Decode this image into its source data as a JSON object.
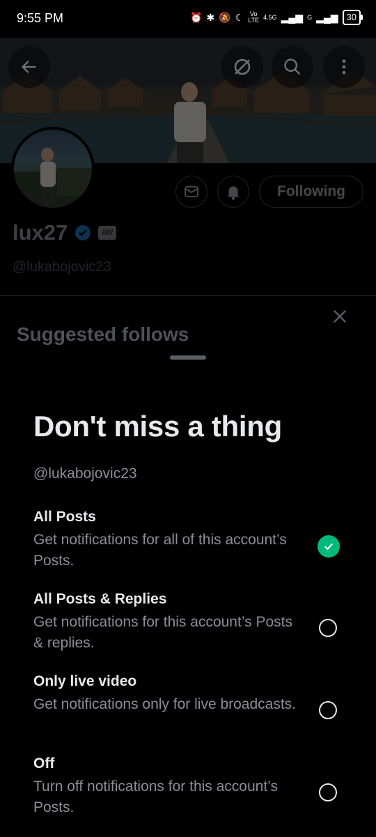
{
  "status_bar": {
    "time": "9:55 PM",
    "network_top": "Vo",
    "network_bottom": "LTE",
    "signal_label": "4.5G",
    "signal_label_2": "G",
    "battery": "30"
  },
  "profile": {
    "display_name": "lux27",
    "handle": "@lukabojovic23",
    "following_label": "Following"
  },
  "sheet": {
    "header": "Suggested follows",
    "title": "Don't miss a thing",
    "handle": "@lukabojovic23",
    "options": [
      {
        "title": "All Posts",
        "desc": "Get notifications for all of this account’s Posts.",
        "selected": true
      },
      {
        "title": "All Posts & Replies",
        "desc": "Get notifications for this account’s Posts & replies.",
        "selected": false
      },
      {
        "title": "Only live video",
        "desc": "Get notifications only for live broadcasts.",
        "selected": false
      },
      {
        "title": "Off",
        "desc": "Turn off notifications for this account’s Posts.",
        "selected": false
      }
    ]
  },
  "colors": {
    "background": "#000000",
    "accent_check": "#00ba7c",
    "verified": "#1d9bf0",
    "muted_text": "#8b8f94"
  },
  "icons": [
    "back-arrow-icon",
    "grok-icon",
    "search-icon",
    "more-vertical-icon",
    "message-icon",
    "bell-icon",
    "verified-badge-icon",
    "close-icon",
    "check-icon"
  ]
}
